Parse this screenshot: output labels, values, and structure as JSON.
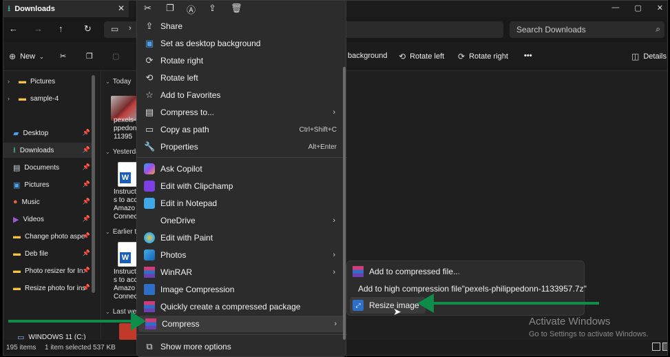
{
  "window": {
    "tab_title": "Downloads",
    "tab_close": "✕",
    "controls": [
      "—",
      "▢",
      "✕"
    ]
  },
  "addressbar": {
    "search_placeholder": "Search Downloads"
  },
  "commandbar": {
    "new_label": "New",
    "set_bg_label": "background",
    "rotate_left_label": "Rotate left",
    "rotate_right_label": "Rotate right",
    "more_label": "•••",
    "details_label": "Details"
  },
  "sidebar": {
    "items": [
      {
        "label": "Pictures",
        "icon": "folder-icon",
        "chevron": "›"
      },
      {
        "label": "sample-4",
        "icon": "folder-icon",
        "chevron": "›"
      },
      {
        "label": "Desktop",
        "icon": "desktop-icon",
        "pinned": true
      },
      {
        "label": "Downloads",
        "icon": "download-icon",
        "pinned": true,
        "selected": true
      },
      {
        "label": "Documents",
        "icon": "documents-icon",
        "pinned": true
      },
      {
        "label": "Pictures",
        "icon": "pictures-icon",
        "pinned": true
      },
      {
        "label": "Music",
        "icon": "music-icon",
        "pinned": true
      },
      {
        "label": "Videos",
        "icon": "videos-icon",
        "pinned": true
      },
      {
        "label": "Change photo aspe",
        "icon": "folder-icon",
        "pinned": true
      },
      {
        "label": "Deb file",
        "icon": "folder-icon",
        "pinned": true
      },
      {
        "label": "Photo resizer for In:",
        "icon": "folder-icon",
        "pinned": true
      },
      {
        "label": "Resize photo for ins",
        "icon": "folder-icon",
        "pinned": true
      },
      {
        "label": "WINDOWS 11 (C:)",
        "icon": "drive-icon"
      }
    ]
  },
  "files": {
    "groups": [
      "Today",
      "Yesterda",
      "Earlier th",
      "Last wee"
    ],
    "items": [
      {
        "lines": [
          "pexels-p",
          "ppedonn",
          "11395"
        ]
      },
      {
        "lines": [
          "Instructi",
          "s to acce",
          "Amazo",
          "Connect"
        ]
      },
      {
        "lines": [
          "Instructi",
          "s to acce",
          "Amazo",
          "Connect"
        ]
      }
    ]
  },
  "statusbar": {
    "count": "195 items",
    "selection": "1 item selected  537 KB"
  },
  "context_menu": {
    "items": [
      {
        "label": "Share",
        "icon": "share-icon"
      },
      {
        "label": "Set as desktop background",
        "icon": "wallpaper-icon"
      },
      {
        "label": "Rotate right",
        "icon": "rotate-right-icon"
      },
      {
        "label": "Rotate left",
        "icon": "rotate-left-icon"
      },
      {
        "label": "Add to Favorites",
        "icon": "star-icon"
      },
      {
        "label": "Compress to...",
        "icon": "zip-icon",
        "submenu": true
      },
      {
        "label": "Copy as path",
        "icon": "copy-path-icon",
        "shortcut": "Ctrl+Shift+C"
      },
      {
        "label": "Properties",
        "icon": "wrench-icon",
        "shortcut": "Alt+Enter"
      },
      {
        "label": "Ask Copilot",
        "icon": "copilot-icon"
      },
      {
        "label": "Edit with Clipchamp",
        "icon": "clipchamp-icon"
      },
      {
        "label": "Edit in Notepad",
        "icon": "notepad-icon"
      },
      {
        "label": "OneDrive",
        "icon": "",
        "submenu": true
      },
      {
        "label": "Edit with Paint",
        "icon": "paint-icon"
      },
      {
        "label": "Photos",
        "icon": "photos-icon",
        "submenu": true
      },
      {
        "label": "WinRAR",
        "icon": "winrar-icon",
        "submenu": true
      },
      {
        "label": "Image Compression",
        "icon": "image-compression-icon"
      },
      {
        "label": "Quickly create a compressed package",
        "icon": "package-icon"
      },
      {
        "label": "Compress",
        "icon": "compress-icon",
        "submenu": true,
        "highlighted": true
      },
      {
        "label": "Show more options",
        "icon": "more-options-icon"
      }
    ],
    "top_icons": [
      "cut-icon",
      "copy-icon",
      "rename-icon",
      "share-icon",
      "delete-icon"
    ]
  },
  "submenu": {
    "items": [
      {
        "label": "Add to compressed file...",
        "icon": "winrar-icon"
      },
      {
        "label": "Add to high compression file\"pexels-philippedonn-1133957.7z\"",
        "icon": "winrar-icon"
      },
      {
        "label": "Resize image",
        "icon": "resize-image-icon",
        "highlighted": true
      }
    ]
  },
  "watermark": {
    "title": "Activate Windows",
    "subtitle": "Go to Settings to activate Windows."
  },
  "colors": {
    "arrow": "#0f8b4a",
    "background": "#1f1f1f",
    "menu": "#2c2c2c"
  }
}
